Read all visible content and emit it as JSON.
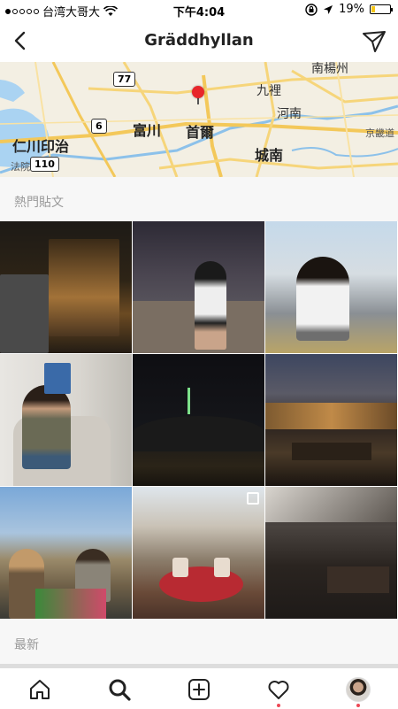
{
  "status_bar": {
    "carrier": "台湾大哥大",
    "time": "下午4:04",
    "battery": "19%",
    "battery_level": 0.19,
    "signal_bars": 1
  },
  "header": {
    "title": "Gräddhyllan",
    "back_icon": "chevron-left-icon",
    "share_icon": "paper-plane-icon"
  },
  "map": {
    "labels": {
      "namyangju": "南楊州",
      "guri": "九裡",
      "hanam": "河南",
      "gyeonggi": "京畿道",
      "bucheon": "富川",
      "seoul": "首爾",
      "incheon": "仁川印治",
      "seongnam": "城南",
      "beopo": "法院",
      "route_77": "77",
      "route_6": "6",
      "route_110": "110"
    }
  },
  "sections": {
    "top_posts": "熱門貼文",
    "recent": "最新"
  },
  "tab_bar": {
    "items": [
      {
        "name": "home",
        "icon": "home-icon"
      },
      {
        "name": "search",
        "icon": "search-icon"
      },
      {
        "name": "add",
        "icon": "plus-square-icon"
      },
      {
        "name": "activity",
        "icon": "heart-icon"
      },
      {
        "name": "profile",
        "icon": "avatar"
      }
    ]
  },
  "colors": {
    "pin": "#e8262a",
    "notification": "#ed4956",
    "section_bg": "#f7f7f7"
  }
}
